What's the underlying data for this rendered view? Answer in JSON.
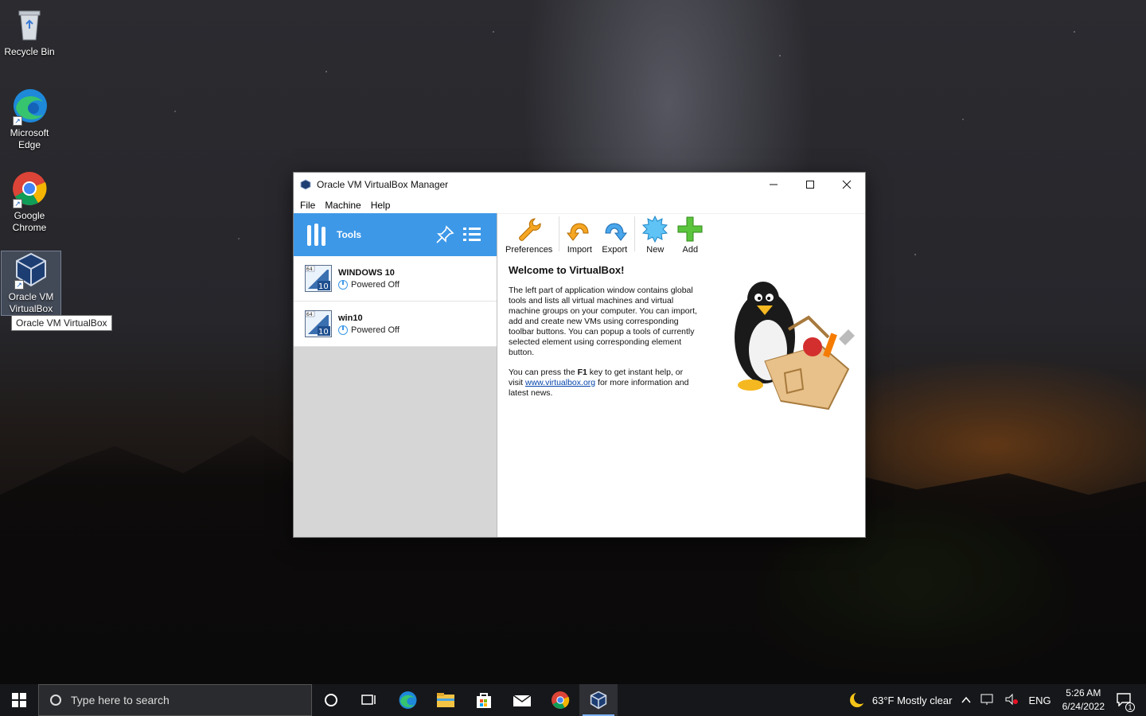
{
  "desktop": {
    "icons": [
      {
        "label": "Recycle Bin"
      },
      {
        "label": "Microsoft Edge"
      },
      {
        "label": "Google Chrome"
      },
      {
        "label": "Oracle VM VirtualBox"
      }
    ],
    "tooltip": "Oracle VM VirtualBox"
  },
  "window": {
    "title": "Oracle VM VirtualBox Manager",
    "menu": [
      "File",
      "Machine",
      "Help"
    ],
    "tools_label": "Tools",
    "vms": [
      {
        "name": "WINDOWS 10",
        "state": "Powered Off",
        "badge": "10",
        "arch": "64"
      },
      {
        "name": "win10",
        "state": "Powered Off",
        "badge": "10",
        "arch": "64"
      }
    ],
    "toolbar": {
      "preferences": "Preferences",
      "import": "Import",
      "export": "Export",
      "new": "New",
      "add": "Add"
    },
    "welcome": {
      "heading": "Welcome to VirtualBox!",
      "para1": "The left part of application window contains global tools and lists all virtual machines and virtual machine groups on your computer. You can import, add and create new VMs using corresponding toolbar buttons. You can popup a tools of currently selected element using corresponding element button.",
      "para2_a": "You can press the ",
      "para2_key": "F1",
      "para2_b": " key to get instant help, or visit ",
      "link": "www.virtualbox.org",
      "para2_c": " for more information and latest news."
    }
  },
  "taskbar": {
    "search_placeholder": "Type here to search",
    "weather": "63°F  Mostly clear",
    "lang": "ENG",
    "time": "5:26 AM",
    "date": "6/24/2022",
    "notification_count": "1"
  },
  "colors": {
    "accent": "#3d98e8",
    "tools_bg": "#3d98e8",
    "left_pane_bg": "#d6d6d6"
  }
}
